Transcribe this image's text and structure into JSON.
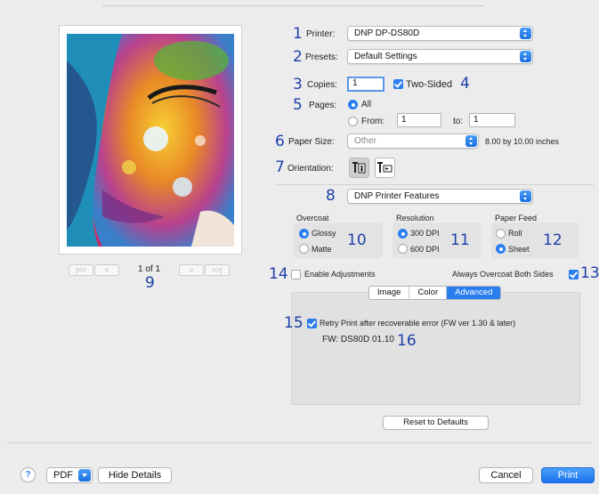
{
  "print_dialog": {
    "printer": {
      "label": "Printer:",
      "value": "DNP DP-DS80D"
    },
    "presets": {
      "label": "Presets:",
      "value": "Default Settings"
    },
    "copies": {
      "label": "Copies:",
      "value": "1",
      "two_sided_label": "Two-Sided",
      "two_sided_checked": true
    },
    "pages": {
      "label": "Pages:",
      "all_label": "All",
      "all_selected": true,
      "from_label": "From:",
      "from_value": "1",
      "to_label": "to:",
      "to_value": "1"
    },
    "paper_size": {
      "label": "Paper Size:",
      "value": "Other",
      "dimensions": "8.00 by 10.00 inches"
    },
    "orientation": {
      "label": "Orientation:",
      "options": [
        "portrait",
        "landscape"
      ],
      "selected": "portrait"
    },
    "section_popup": {
      "value": "DNP Printer Features"
    },
    "overcoat": {
      "title": "Overcoat",
      "options": [
        "Glossy",
        "Matte"
      ],
      "selected": "Glossy"
    },
    "resolution": {
      "title": "Resolution",
      "options": [
        "300 DPI",
        "600 DPI"
      ],
      "selected": "300 DPI"
    },
    "paper_feed": {
      "title": "Paper Feed",
      "options": [
        "Roll",
        "Sheet"
      ],
      "selected": "Sheet"
    },
    "enable_adjustments": {
      "label": "Enable Adjustments",
      "checked": false
    },
    "always_overcoat": {
      "label": "Always Overcoat Both Sides",
      "checked": true
    },
    "tabs": [
      "Image",
      "Color",
      "Advanced"
    ],
    "active_tab": "Advanced",
    "retry_print": {
      "label": "Retry Print after recoverable error (FW ver 1.30 & later)",
      "checked": true
    },
    "firmware": "FW: DS80D 01.10",
    "reset_button": "Reset to Defaults",
    "preview": {
      "page_indicator": "1 of 1",
      "nav_first": "|<<",
      "nav_prev": "<",
      "nav_next": ">",
      "nav_last": ">>|"
    },
    "bottom": {
      "help": "?",
      "pdf": "PDF",
      "hide_details": "Hide Details",
      "cancel": "Cancel",
      "print": "Print"
    }
  },
  "annotations": {
    "n1": "1",
    "n2": "2",
    "n3": "3",
    "n4": "4",
    "n5": "5",
    "n6": "6",
    "n7": "7",
    "n8": "8",
    "n9": "9",
    "n10": "10",
    "n11": "11",
    "n12": "12",
    "n13": "13",
    "n14": "14",
    "n15": "15",
    "n16": "16"
  },
  "colors": {
    "accent": "#2a7ef0",
    "annotation": "#1d3fa8",
    "background": "#ececec"
  },
  "icons": [
    "help-icon",
    "chevron-updown-icon",
    "portrait-orientation-icon",
    "landscape-orientation-icon"
  ]
}
